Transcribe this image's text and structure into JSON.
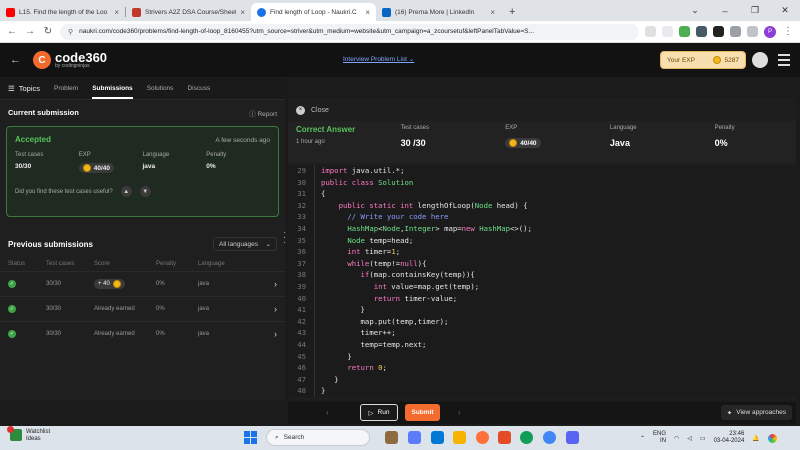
{
  "browser": {
    "tabs": [
      {
        "title": "L15. Find the length of the Loo",
        "color": "#ff0000"
      },
      {
        "title": "Strivers A2Z DSA Course/Sheet",
        "color": "#c0392b"
      },
      {
        "title": "Find length of Loop - Naukri.C",
        "color": "#1a73e8"
      },
      {
        "title": "(16) Prerna More | LinkedIn",
        "color": "#0a66c2"
      }
    ],
    "new_tab": "+",
    "url": "naukri.com/code360/problems/find-length-of-loop_8160455?utm_source=striver&utm_medium=website&utm_campaign=a_zcoursetuf&leftPanelTabValue=S..."
  },
  "header": {
    "logo_badge": "C",
    "logo_main": "code360",
    "logo_sub": "by codingninjas",
    "problem_list": "Interview Problem List",
    "exp_label": "Your EXP",
    "exp_value": "5287"
  },
  "left": {
    "topics": "Topics",
    "tabs": [
      "Problem",
      "Submissions",
      "Solutions",
      "Discuss"
    ],
    "current_title": "Current submission",
    "report": "Report",
    "status": "Accepted",
    "time_ago": "A few seconds ago",
    "stats": [
      {
        "label": "Test cases",
        "value": "30/30"
      },
      {
        "label": "EXP",
        "value": "40/40"
      },
      {
        "label": "Language",
        "value": "java"
      },
      {
        "label": "Penalty",
        "value": "0%"
      }
    ],
    "useful_q": "Did you find these test cases useful?",
    "prev_title": "Previous submissions",
    "lang_filter": "All languages",
    "columns": [
      "Status",
      "Test cases",
      "Score",
      "Penalty",
      "Language"
    ],
    "rows": [
      {
        "tests": "30/30",
        "score": "+ 40",
        "penalty": "0%",
        "lang": "java"
      },
      {
        "tests": "30/30",
        "score": "Already earned",
        "penalty": "0%",
        "lang": "java"
      },
      {
        "tests": "30/30",
        "score": "Already earned",
        "penalty": "0%",
        "lang": "java"
      }
    ]
  },
  "right": {
    "close": "Close",
    "result": "Correct Answer",
    "result_ago": "1 hour ago",
    "summary": [
      {
        "label": "Test cases",
        "value": "30 /30"
      },
      {
        "label": "EXP",
        "value": "40/40"
      },
      {
        "label": "Language",
        "value": "Java"
      },
      {
        "label": "Penalty",
        "value": "0%"
      }
    ],
    "run": "Run",
    "submit": "Submit",
    "view": "View approaches"
  },
  "taskbar": {
    "weather_title": "Watchlist",
    "weather_sub": "Ideas",
    "search": "Search",
    "lang": "ENG",
    "region": "IN",
    "time": "23:46",
    "date": "03-04-2024"
  },
  "code_lines": [
    {
      "n": "29",
      "html": "<span class='kw'>import</span> java.util.*;"
    },
    {
      "n": "30",
      "html": "<span class='kw'>public class</span> <span class='ty'>Solution</span>"
    },
    {
      "n": "31",
      "html": "{"
    },
    {
      "n": "32",
      "html": "    <span class='kw'>public static int</span> lengthOfLoop(<span class='ty'>Node</span> head) {"
    },
    {
      "n": "33",
      "html": "      <span class='cm'>// Write your code here</span>"
    },
    {
      "n": "34",
      "html": "      <span class='ty'>HashMap</span>&lt;<span class='ty'>Node</span>,<span class='ty'>Integer</span>&gt; map=<span class='kw'>new</span> <span class='ty'>HashMap</span>&lt;&gt;();"
    },
    {
      "n": "35",
      "html": "      <span class='ty'>Node</span> temp=head;"
    },
    {
      "n": "36",
      "html": "      <span class='kw'>int</span> timer=<span class='nm'>1</span>;"
    },
    {
      "n": "37",
      "html": "      <span class='kw'>while</span>(temp!=<span class='kw'>null</span>){"
    },
    {
      "n": "38",
      "html": "         <span class='kw'>if</span>(map.containsKey(temp)){"
    },
    {
      "n": "39",
      "html": "            <span class='kw'>int</span> value=map.get(temp);"
    },
    {
      "n": "40",
      "html": "            <span class='kw'>return</span> timer-value;"
    },
    {
      "n": "41",
      "html": "         }"
    },
    {
      "n": "42",
      "html": "         map.put(temp,timer);"
    },
    {
      "n": "43",
      "html": "         timer++;"
    },
    {
      "n": "44",
      "html": "         temp=temp.next;"
    },
    {
      "n": "45",
      "html": "      }"
    },
    {
      "n": "46",
      "html": "      <span class='kw'>return</span> <span class='nm'>0</span>;"
    },
    {
      "n": "47",
      "html": "   }"
    },
    {
      "n": "48",
      "html": "}"
    }
  ]
}
